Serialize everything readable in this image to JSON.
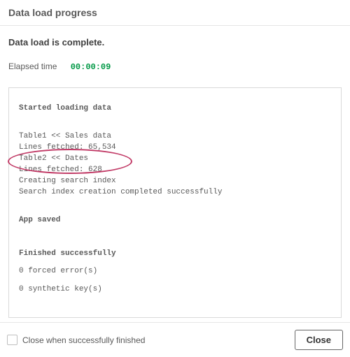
{
  "header": {
    "title": "Data load progress"
  },
  "status_message": "Data load is complete.",
  "elapsed": {
    "label": "Elapsed time",
    "value": "00:00:09"
  },
  "log": {
    "start_heading": "Started loading data",
    "lines": [
      "Table1 << Sales data",
      "Lines fetched: 65,534",
      "Table2 << Dates",
      "Lines fetched: 628",
      "Creating search index",
      "Search index creation completed successfully"
    ],
    "saved_heading": "App saved",
    "finished_heading": "Finished successfully",
    "finished_lines": [
      "0 forced error(s)",
      "0 synthetic key(s)"
    ]
  },
  "footer": {
    "checkbox_label": "Close when successfully finished",
    "close_button": "Close"
  }
}
